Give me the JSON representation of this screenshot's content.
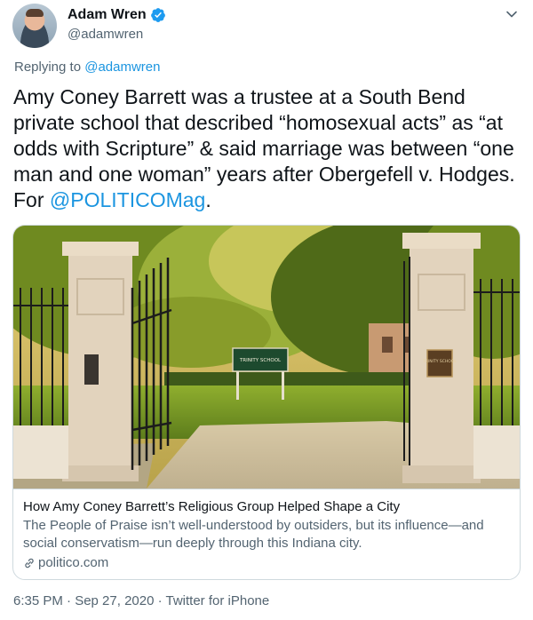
{
  "author": {
    "name": "Adam Wren",
    "handle": "@adamwren",
    "verified_icon": "verified-badge-icon"
  },
  "reply": {
    "prefix": "Replying to ",
    "target": "@adamwren"
  },
  "tweet": {
    "text_main": "Amy Coney Barrett was a trustee at a South Bend private school that described “homosexual acts” as “at odds with Scripture” & said marriage was between “one man and one woman” years after Obergefell v. Hodges. For ",
    "mention": "@POLITICOMag",
    "text_end": "."
  },
  "card": {
    "image_sign_left": "TRINITY SCHOOL",
    "image_sign_right": "TRINITY SCHOOL",
    "title": "How Amy Coney Barrett’s Religious Group Helped Shape a City",
    "description": "The People of Praise isn’t well-understood by outsiders, but its influence—and social conservatism—run deeply through this Indiana city.",
    "domain": "politico.com"
  },
  "footer": {
    "meta": "6:35 PM · Sep 27, 2020 · Twitter for iPhone"
  },
  "colors": {
    "link": "#1b95e0",
    "secondary_text": "#536471",
    "primary_text": "#0f1419",
    "border": "#cfd9de"
  }
}
